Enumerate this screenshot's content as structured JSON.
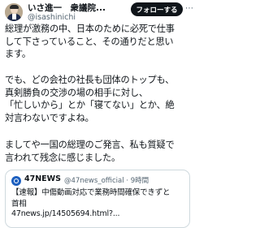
{
  "author": {
    "display_name": "いさ進一　衆議院...",
    "handle": "@isashinichi"
  },
  "follow_label": "フォローする",
  "more_icon": "more-icon",
  "body": {
    "p1": [
      "総理が激務の中、日本のために必死で仕事",
      "して下さっていること、その通りだと思い",
      "ます。"
    ],
    "p2": [
      "でも、どの会社の社長も団体のトップも、",
      "真剣勝負の交渉の場の相手に対し、",
      "「忙しいから」とか「寝てない」とか、絶",
      "対言わないですよね。"
    ],
    "p3": [
      "ましてや一国の総理のご発言、私も質疑で",
      "言われて残念に感じました。"
    ]
  },
  "quote": {
    "source_name": "47NEWS",
    "source_handle": "@47news_official · 9時間",
    "lines": [
      "【速報】中傷動画対応で業務時間確保できずと",
      "首相",
      "47news.jp/14505694.html?..."
    ]
  }
}
